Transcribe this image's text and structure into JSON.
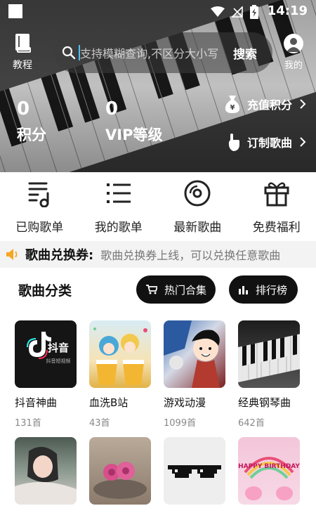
{
  "status_bar": {
    "time": "14:19"
  },
  "header": {
    "tutorial_label": "教程",
    "mine_label": "我的",
    "search": {
      "placeholder": "支持模糊查询,不区分大小写",
      "button_label": "搜索"
    },
    "stats": [
      {
        "value": "0",
        "label": "积分"
      },
      {
        "value": "0",
        "label": "VIP等级"
      }
    ],
    "links": [
      {
        "label": "充值积分",
        "icon": "money-bag-icon"
      },
      {
        "label": "订制歌曲",
        "icon": "hand-pointer-icon"
      }
    ]
  },
  "quick_menu": [
    {
      "label": "已购歌单",
      "icon": "music-list-icon"
    },
    {
      "label": "我的歌单",
      "icon": "list-icon"
    },
    {
      "label": "最新歌曲",
      "icon": "disc-icon"
    },
    {
      "label": "免费福利",
      "icon": "gift-icon"
    }
  ],
  "notice": {
    "title": "歌曲兑换券:",
    "text": "歌曲兑换券上线，可以兑换任意歌曲"
  },
  "category": {
    "title": "歌曲分类",
    "buttons": [
      {
        "label": "热门合集",
        "icon": "cart-icon"
      },
      {
        "label": "排行榜",
        "icon": "bar-chart-icon"
      }
    ],
    "items": [
      {
        "title": "抖音神曲",
        "count": "131首"
      },
      {
        "title": "血洗B站",
        "count": "43首"
      },
      {
        "title": "游戏动漫",
        "count": "1099首"
      },
      {
        "title": "经典钢琴曲",
        "count": "642首"
      },
      {
        "title": "",
        "count": ""
      },
      {
        "title": "",
        "count": ""
      },
      {
        "title": "",
        "count": ""
      },
      {
        "title": "",
        "count": ""
      }
    ],
    "thumb_text": {
      "douyin": "抖音",
      "douyin_sub": "抖音短视频",
      "birthday": "HAPPY BIRTHDAY"
    }
  }
}
